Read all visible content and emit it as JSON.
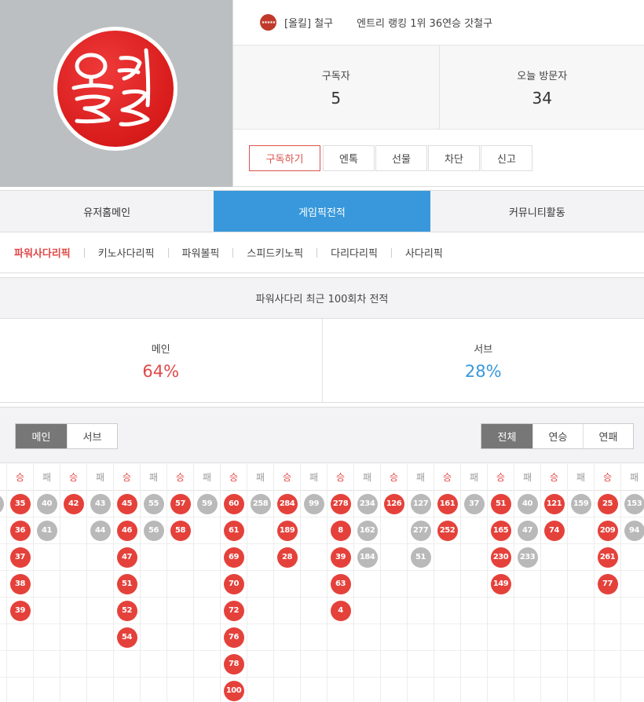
{
  "profile": {
    "rank_badge": "★★★★★",
    "nickname": "[올킬] 철구",
    "title": "엔트리 랭킹 1위 36연승 갓철구",
    "logo_text": "올킬",
    "stats": [
      {
        "label": "구독자",
        "value": "5"
      },
      {
        "label": "오늘 방문자",
        "value": "34"
      }
    ],
    "actions": [
      "구독하기",
      "엔톡",
      "선물",
      "차단",
      "신고"
    ]
  },
  "main_tabs": [
    "유저홈메인",
    "게임픽전적",
    "커뮤니티활동"
  ],
  "main_tab_active": 1,
  "sub_tabs": [
    "파워사다리픽",
    "키노사다리픽",
    "파워볼픽",
    "스피드키노픽",
    "다리다리픽",
    "사다리픽"
  ],
  "summary": {
    "title": "파워사다리 최근 100회차 전적",
    "main_label": "메인",
    "main_pct": "64%",
    "sub_label": "서브",
    "sub_pct": "28%"
  },
  "filters": {
    "view": [
      "메인",
      "서브"
    ],
    "kind": [
      "전체",
      "연승",
      "연패"
    ]
  },
  "legend": {
    "win": "승",
    "lose": "패"
  },
  "colors": {
    "win": "#e5413b",
    "lose": "#b9b9b9",
    "accent": "#3898db"
  },
  "streaks": [
    {
      "result": "lose",
      "rounds": [
        ""
      ]
    },
    {
      "result": "win",
      "rounds": [
        "35",
        "36",
        "37",
        "38",
        "39"
      ]
    },
    {
      "result": "lose",
      "rounds": [
        "40",
        "41"
      ]
    },
    {
      "result": "win",
      "rounds": [
        "42"
      ]
    },
    {
      "result": "lose",
      "rounds": [
        "43",
        "44"
      ]
    },
    {
      "result": "win",
      "rounds": [
        "45",
        "46",
        "47",
        "51",
        "52",
        "54"
      ]
    },
    {
      "result": "lose",
      "rounds": [
        "55",
        "56"
      ]
    },
    {
      "result": "win",
      "rounds": [
        "57",
        "58"
      ]
    },
    {
      "result": "lose",
      "rounds": [
        "59"
      ]
    },
    {
      "result": "win",
      "rounds": [
        "60",
        "61",
        "69",
        "70",
        "72",
        "76",
        "78",
        "100"
      ]
    },
    {
      "result": "lose",
      "rounds": [
        "258"
      ]
    },
    {
      "result": "win",
      "rounds": [
        "284",
        "189",
        "28"
      ]
    },
    {
      "result": "lose",
      "rounds": [
        "99"
      ]
    },
    {
      "result": "win",
      "rounds": [
        "278",
        "8",
        "39",
        "63",
        "4"
      ]
    },
    {
      "result": "lose",
      "rounds": [
        "234",
        "162",
        "184"
      ]
    },
    {
      "result": "win",
      "rounds": [
        "126"
      ]
    },
    {
      "result": "lose",
      "rounds": [
        "127",
        "277",
        "51"
      ]
    },
    {
      "result": "win",
      "rounds": [
        "161",
        "252"
      ]
    },
    {
      "result": "lose",
      "rounds": [
        "37"
      ]
    },
    {
      "result": "win",
      "rounds": [
        "51",
        "165",
        "230",
        "149"
      ]
    },
    {
      "result": "lose",
      "rounds": [
        "40",
        "47",
        "233"
      ]
    },
    {
      "result": "win",
      "rounds": [
        "121",
        "74"
      ]
    },
    {
      "result": "lose",
      "rounds": [
        "159"
      ]
    },
    {
      "result": "win",
      "rounds": [
        "25",
        "209",
        "261",
        "77"
      ]
    },
    {
      "result": "lose",
      "rounds": [
        "153",
        "94"
      ]
    }
  ]
}
